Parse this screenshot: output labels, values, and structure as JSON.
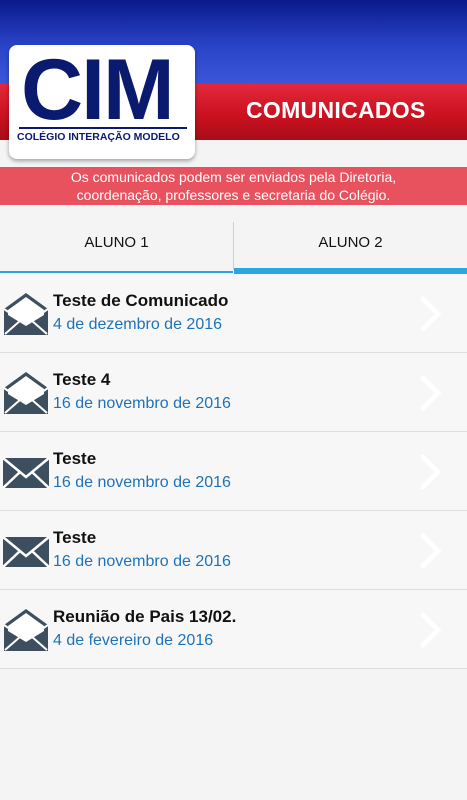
{
  "header": {
    "title": "COMUNICADOS",
    "logo": {
      "mark": "CIM",
      "subtitle": "COLÉGIO INTERAÇÃO MODELO"
    }
  },
  "notice": {
    "line1": "Os comunicados podem ser enviados pela Diretoria,",
    "line2": "coordenação, professores e secretaria do Colégio."
  },
  "tabs": [
    {
      "label": "ALUNO 1",
      "selected": false
    },
    {
      "label": "ALUNO 2",
      "selected": true
    }
  ],
  "messages": [
    {
      "title": "Teste de Comunicado",
      "date": "4 de dezembro de 2016",
      "icon": "envelope-open-icon"
    },
    {
      "title": "Teste 4",
      "date": "16 de novembro de 2016",
      "icon": "envelope-open-icon"
    },
    {
      "title": "Teste",
      "date": "16 de novembro de 2016",
      "icon": "envelope-closed-icon"
    },
    {
      "title": "Teste",
      "date": "16 de novembro de 2016",
      "icon": "envelope-closed-icon"
    },
    {
      "title": "Reunião de Pais 13/02.",
      "date": "4 de fevereiro de 2016",
      "icon": "envelope-open-icon"
    }
  ],
  "colors": {
    "header_blue": "#2a44c8",
    "header_red": "#c9101f",
    "notice_bg": "#e8525f",
    "tab_accent": "#29a8e0",
    "date_text": "#1e72b8",
    "icon_color": "#3d4f5e"
  }
}
